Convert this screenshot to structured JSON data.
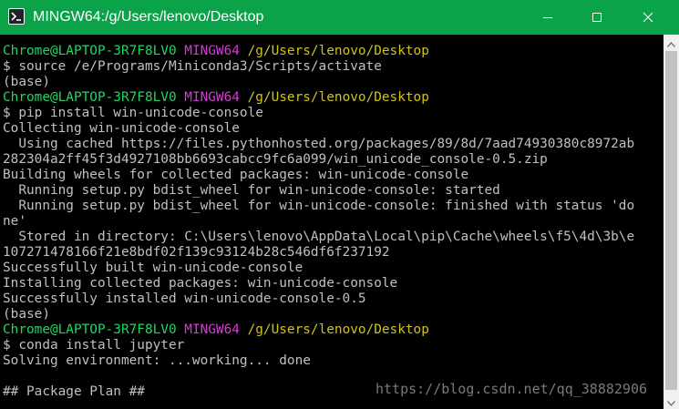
{
  "window": {
    "title": "MINGW64:/g/Users/lenovo/Desktop",
    "icons": {
      "app": "mingw-app-icon",
      "minimize": "minimize-icon",
      "maximize": "maximize-icon",
      "close": "close-icon"
    }
  },
  "terminal": {
    "colors": {
      "user": "#1ed760",
      "host": "#d63bd6",
      "path": "#cfc31c",
      "text": "#c0c0c0",
      "background": "#000000"
    },
    "lines": [
      {
        "user": "Chrome@LAPTOP-3R7F8LV0",
        "host": "MINGW64",
        "path": "/g/Users/lenovo/Desktop"
      },
      {
        "text": "$ source /e/Programs/Miniconda3/Scripts/activate"
      },
      {
        "text": "(base)"
      },
      {
        "user": "Chrome@LAPTOP-3R7F8LV0",
        "host": "MINGW64",
        "path": "/g/Users/lenovo/Desktop"
      },
      {
        "text": "$ pip install win-unicode-console"
      },
      {
        "text": "Collecting win-unicode-console"
      },
      {
        "text": "  Using cached https://files.pythonhosted.org/packages/89/8d/7aad74930380c8972ab"
      },
      {
        "text": "282304a2ff45f3d4927108bb6693cabcc9fc6a099/win_unicode_console-0.5.zip"
      },
      {
        "text": "Building wheels for collected packages: win-unicode-console"
      },
      {
        "text": "  Running setup.py bdist_wheel for win-unicode-console: started"
      },
      {
        "text": "  Running setup.py bdist_wheel for win-unicode-console: finished with status 'do"
      },
      {
        "text": "ne'"
      },
      {
        "text": "  Stored in directory: C:\\Users\\lenovo\\AppData\\Local\\pip\\Cache\\wheels\\f5\\4d\\3b\\e"
      },
      {
        "text": "107271478166f21e8bdf02f139c93124b28c546df6f237192"
      },
      {
        "text": "Successfully built win-unicode-console"
      },
      {
        "text": "Installing collected packages: win-unicode-console"
      },
      {
        "text": "Successfully installed win-unicode-console-0.5"
      },
      {
        "text": "(base)"
      },
      {
        "user": "Chrome@LAPTOP-3R7F8LV0",
        "host": "MINGW64",
        "path": "/g/Users/lenovo/Desktop"
      },
      {
        "text": "$ conda install jupyter"
      },
      {
        "text": "Solving environment: ...working... done"
      },
      {
        "text": ""
      },
      {
        "text": "## Package Plan ##"
      }
    ]
  },
  "scrollbar": {
    "up_icon": "scroll-up-arrow-icon",
    "down_icon": "scroll-down-arrow-icon"
  },
  "watermark": "https://blog.csdn.net/qq_38882906"
}
